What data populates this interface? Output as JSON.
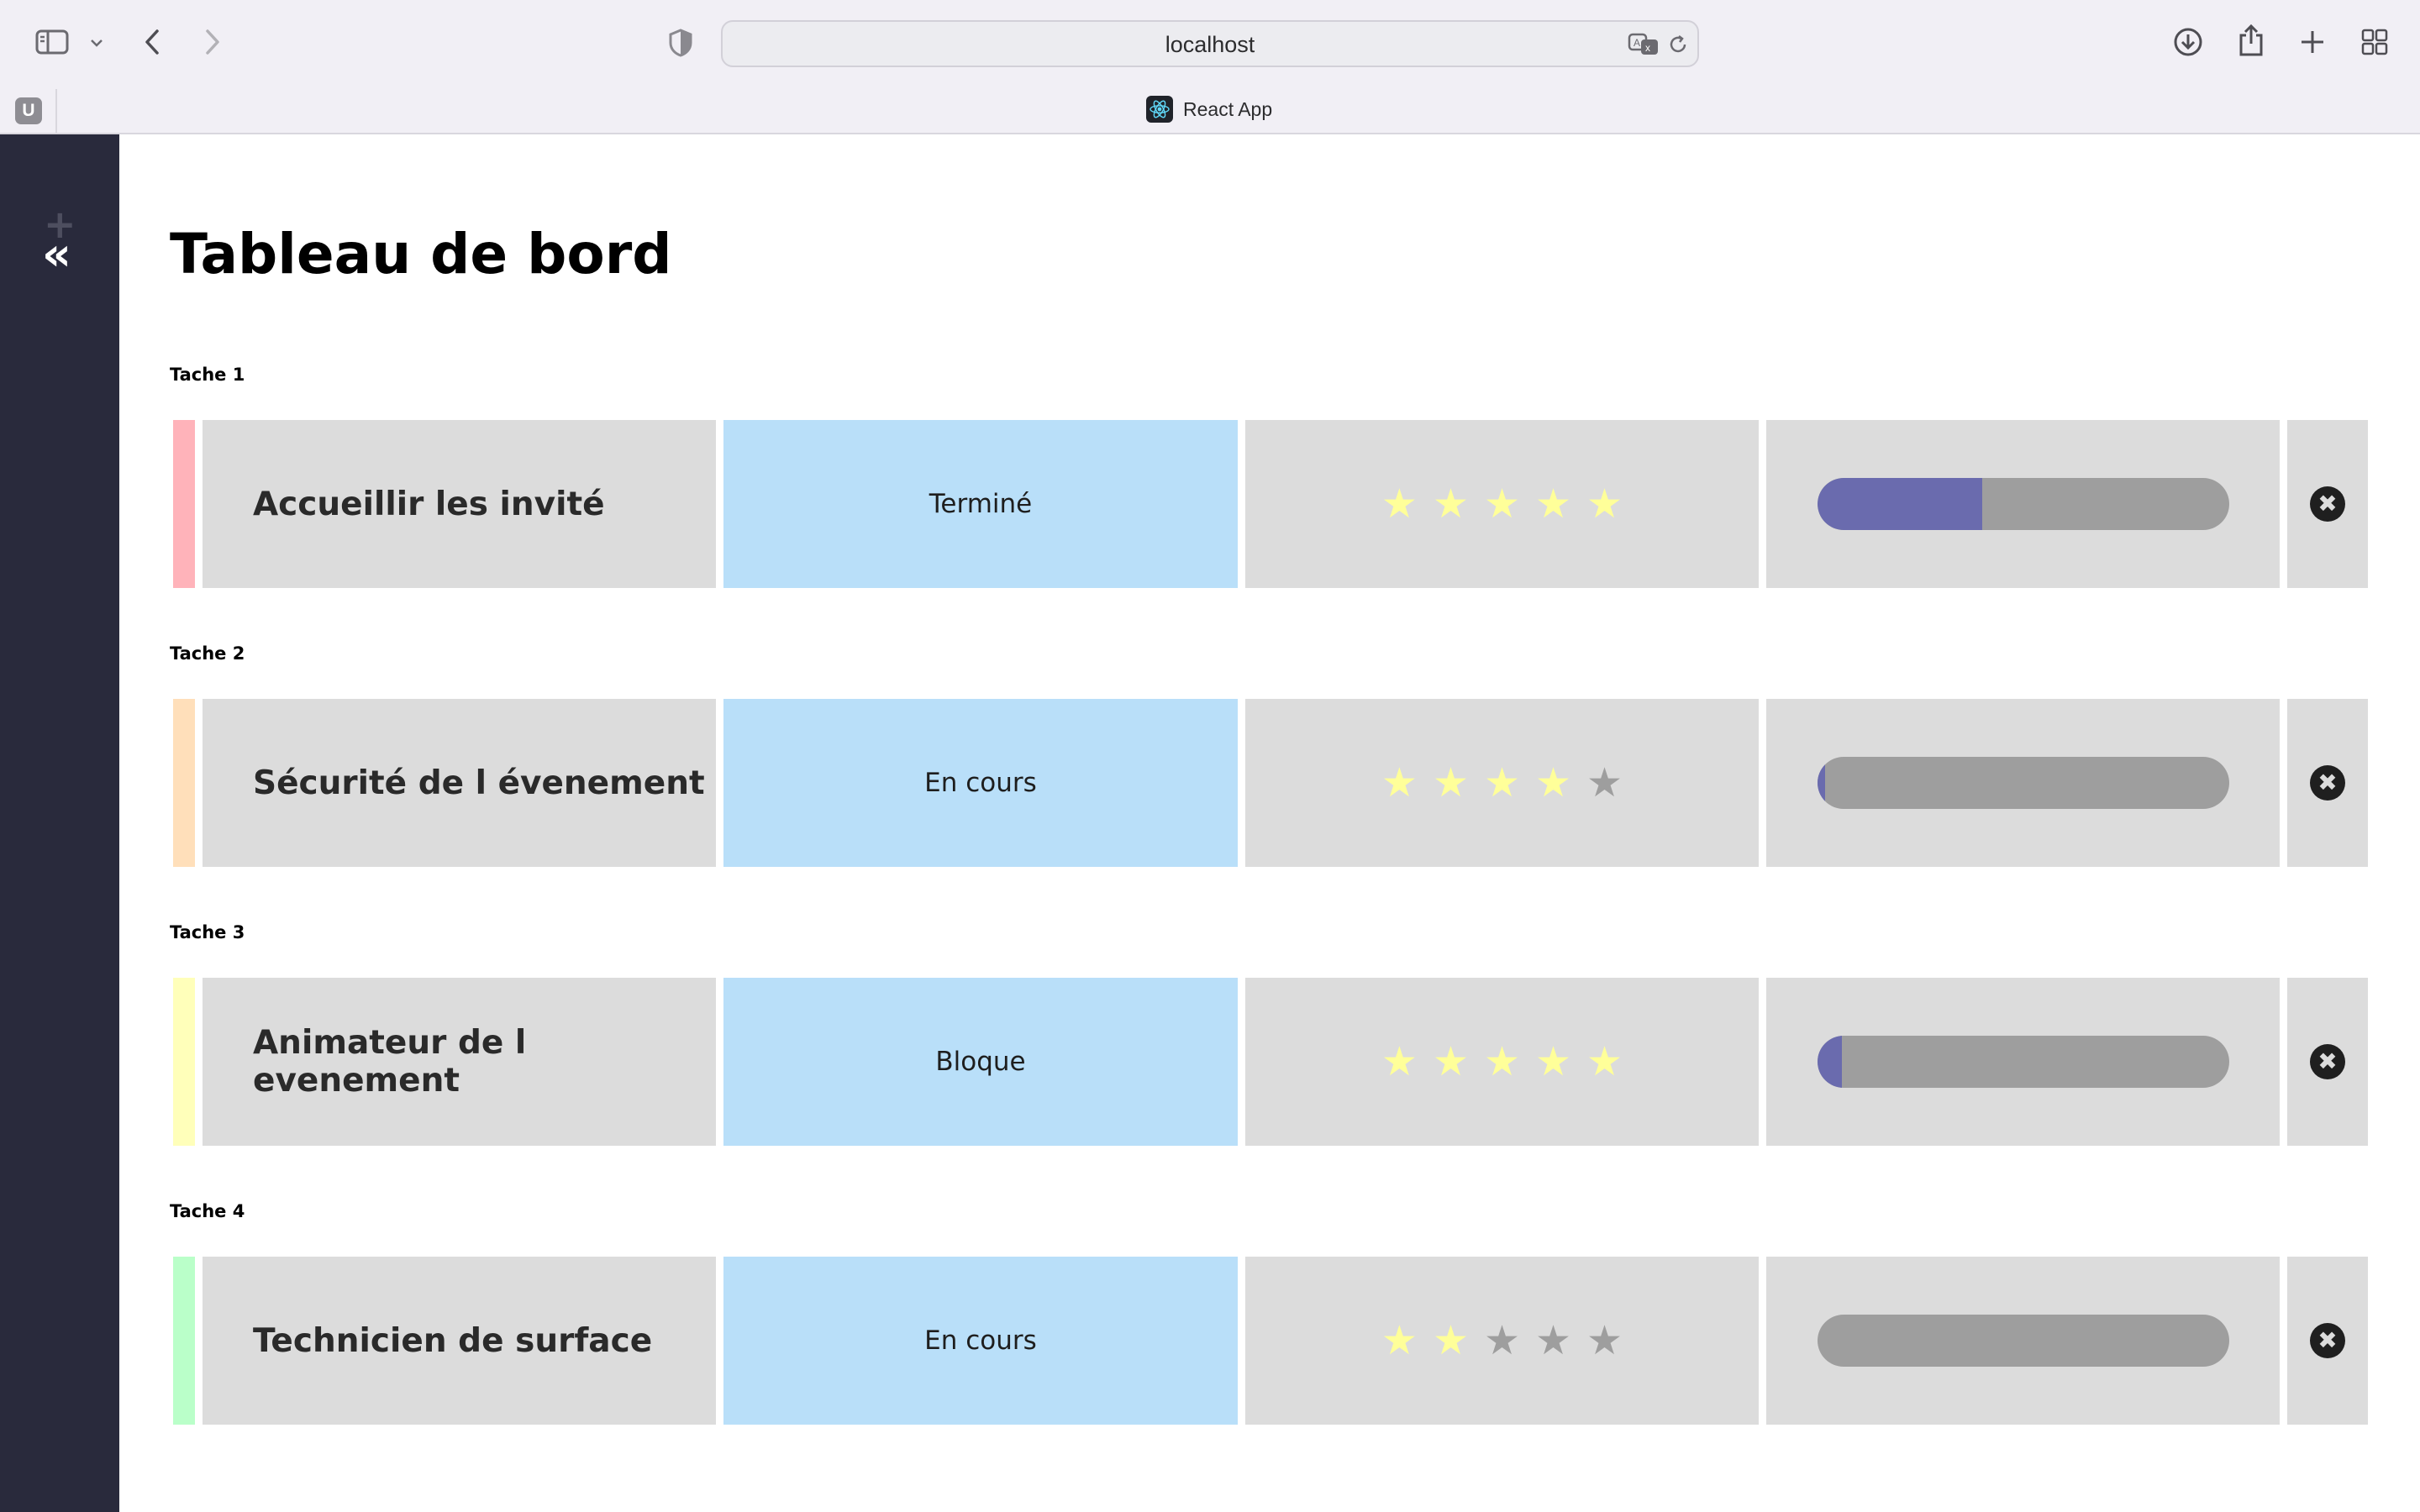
{
  "browser": {
    "url": "localhost",
    "tab_badge": "U",
    "tab_title": "React App",
    "icons": [
      "sidebar-toggle-icon",
      "chevron-down-icon",
      "back-icon",
      "forward-icon",
      "shield-icon",
      "translate-icon",
      "reload-icon",
      "download-icon",
      "share-icon",
      "new-tab-icon",
      "tab-overview-icon",
      "react-logo-icon"
    ]
  },
  "sidebar": {
    "add_symbol": "+",
    "collapse_symbol": "«"
  },
  "page": {
    "title": "Tableau de bord"
  },
  "tasks": [
    {
      "label": "Tache 1",
      "name": "Accueillir les invité",
      "status": "Terminé",
      "color": "#ffb3ba",
      "rating": 5,
      "max_rating": 5,
      "progress": 0.4
    },
    {
      "label": "Tache 2",
      "name": "Sécurité de l évenement",
      "status": "En cours",
      "color": "#ffdfba",
      "rating": 4,
      "max_rating": 5,
      "progress": 0.02
    },
    {
      "label": "Tache 3",
      "name": "Animateur de l evenement",
      "status": "Bloque",
      "color": "#ffffba",
      "rating": 5,
      "max_rating": 5,
      "progress": 0.06
    },
    {
      "label": "Tache 4",
      "name": "Technicien de surface",
      "status": "En cours",
      "color": "#baffc9",
      "rating": 2,
      "max_rating": 5,
      "progress": 0.0
    }
  ],
  "colors": {
    "star_on": "#ffff99",
    "star_off": "#9e9e9e",
    "progress_fill": "#6a6bae",
    "status_bg": "#b9dff9",
    "sidebar_bg": "#292a3c"
  },
  "star_glyph": "★",
  "delete_glyph": "✖"
}
